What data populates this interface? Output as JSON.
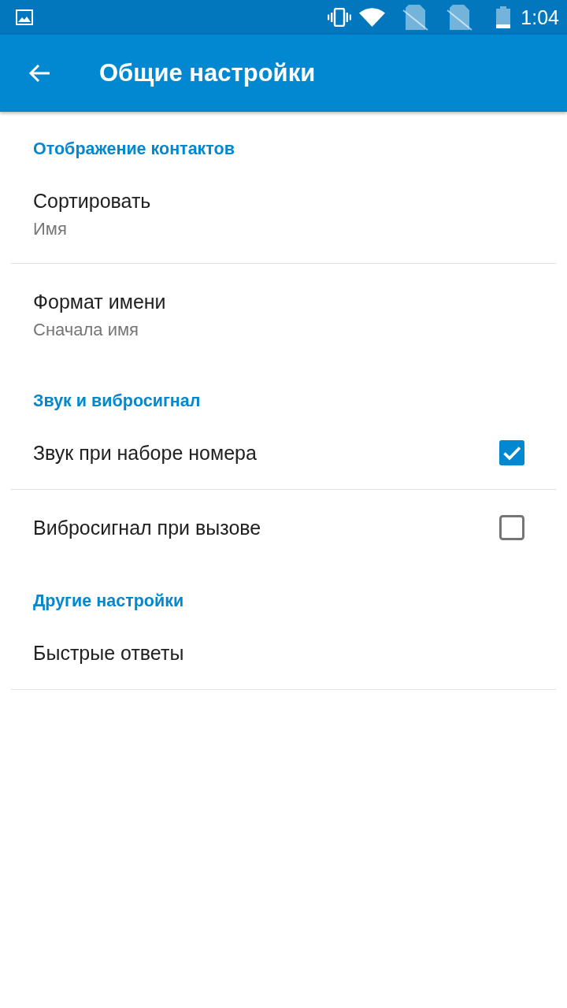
{
  "status_bar": {
    "time": "1:04"
  },
  "toolbar": {
    "title": "Общие настройки"
  },
  "sections": [
    {
      "header": "Отображение контактов",
      "items": [
        {
          "kind": "detail",
          "title": "Сортировать",
          "summary": "Имя"
        },
        {
          "kind": "detail",
          "title": "Формат имени",
          "summary": "Сначала имя"
        }
      ]
    },
    {
      "header": "Звук и вибросигнал",
      "items": [
        {
          "kind": "checkbox",
          "title": "Звук при наборе номера",
          "checked": true
        },
        {
          "kind": "checkbox",
          "title": "Вибросигнал при вызове",
          "checked": false
        }
      ]
    },
    {
      "header": "Другие настройки",
      "items": [
        {
          "kind": "plain",
          "title": "Быстрые ответы"
        }
      ]
    }
  ]
}
